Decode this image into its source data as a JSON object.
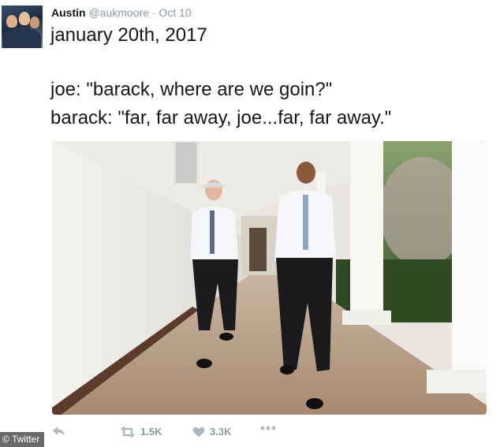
{
  "tweet": {
    "author_name": "Austin",
    "author_handle": "@aukmoore",
    "separator": "·",
    "date": "Oct 10",
    "lines": [
      "january 20th, 2017",
      "joe: \"barack, where are we goin?\"",
      "barack: \"far, far away, joe...far, far away.\""
    ]
  },
  "actions": {
    "reply_icon": "reply-icon",
    "retweet_icon": "retweet-icon",
    "retweet_count": "1.5K",
    "like_icon": "heart-icon",
    "like_count": "3.3K",
    "more_icon": "more-icon"
  },
  "credit": "© Twitter",
  "colors": {
    "text": "#14171a",
    "muted": "#8899a6",
    "credit_bg": "#6a6a6a"
  }
}
